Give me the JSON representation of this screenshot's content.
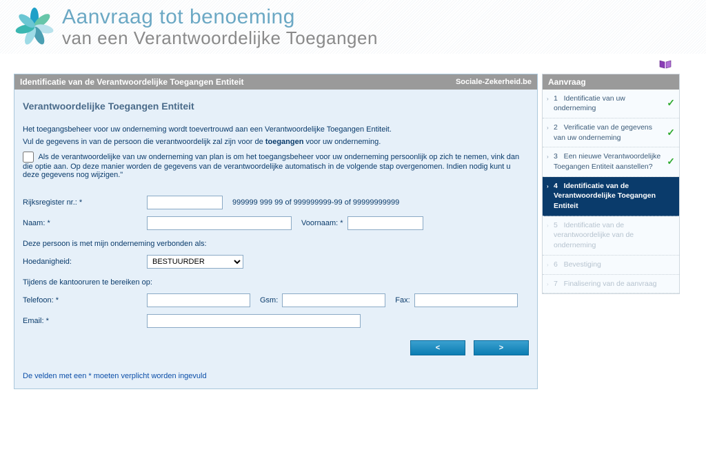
{
  "banner": {
    "line1": "Aanvraag tot benoeming",
    "line2": "van een Verantwoordelijke Toegangen"
  },
  "panel": {
    "header_title": "Identificatie van de Verantwoordelijke Toegangen Entiteit",
    "header_brand": "Sociale-Zekerheid.be",
    "subtitle": "Verantwoordelijke Toegangen Entiteit",
    "intro1": "Het toegangsbeheer voor uw onderneming wordt toevertrouwd aan een Verantwoordelijke Toegangen Entiteit.",
    "intro2_pre": "Vul de gegevens in van de persoon die verantwoordelijk zal zijn voor de ",
    "intro2_bold": "toegangen",
    "intro2_post": " voor uw onderneming.",
    "checkbox_text": "Als de verantwoordelijke van uw onderneming van plan is om het toegangsbeheer voor uw onderneming persoonlijk op zich te nemen, vink dan die optie aan. Op deze manier worden de gegevens van de verantwoordelijke automatisch in de volgende stap overgenomen. Indien nodig kunt u deze gegevens nog wijzigen.\"",
    "labels": {
      "rrn": "Rijksregister nr.: *",
      "rrn_hint": "999999 999 99 of 999999999-99 of 99999999999",
      "naam": "Naam: *",
      "voornaam": "Voornaam: *",
      "linked": "Deze persoon is met mijn onderneming verbonden als:",
      "hoedanigheid": "Hoedanigheid:",
      "hours": "Tijdens de kantooruren te bereiken op:",
      "telefoon": "Telefoon: *",
      "gsm": "Gsm:",
      "fax": "Fax:",
      "email": "Email:  *"
    },
    "values": {
      "rrn": "",
      "naam": "",
      "voornaam": "",
      "hoedanigheid_selected": "BESTUURDER",
      "telefoon": "",
      "gsm": "",
      "fax": "",
      "email": ""
    },
    "nav": {
      "prev": "<",
      "next": ">"
    },
    "footnote": "De velden met een * moeten verplicht worden ingevuld"
  },
  "sidebar": {
    "header": "Aanvraag",
    "steps": [
      {
        "num": "1",
        "label": "Identificatie van uw onderneming",
        "state": "done"
      },
      {
        "num": "2",
        "label": "Verificatie van de gegevens van uw onderneming",
        "state": "done"
      },
      {
        "num": "3",
        "label": "Een nieuwe Verantwoordelijke Toegangen Entiteit aanstellen?",
        "state": "done"
      },
      {
        "num": "4",
        "label": "Identificatie van de Verantwoordelijke Toegangen Entiteit",
        "state": "current"
      },
      {
        "num": "5",
        "label": "Identificatie van de verantwoordelijke van de onderneming",
        "state": "future"
      },
      {
        "num": "6",
        "label": "Bevestiging",
        "state": "future"
      },
      {
        "num": "7",
        "label": "Finalisering van de aanvraag",
        "state": "future"
      }
    ]
  }
}
